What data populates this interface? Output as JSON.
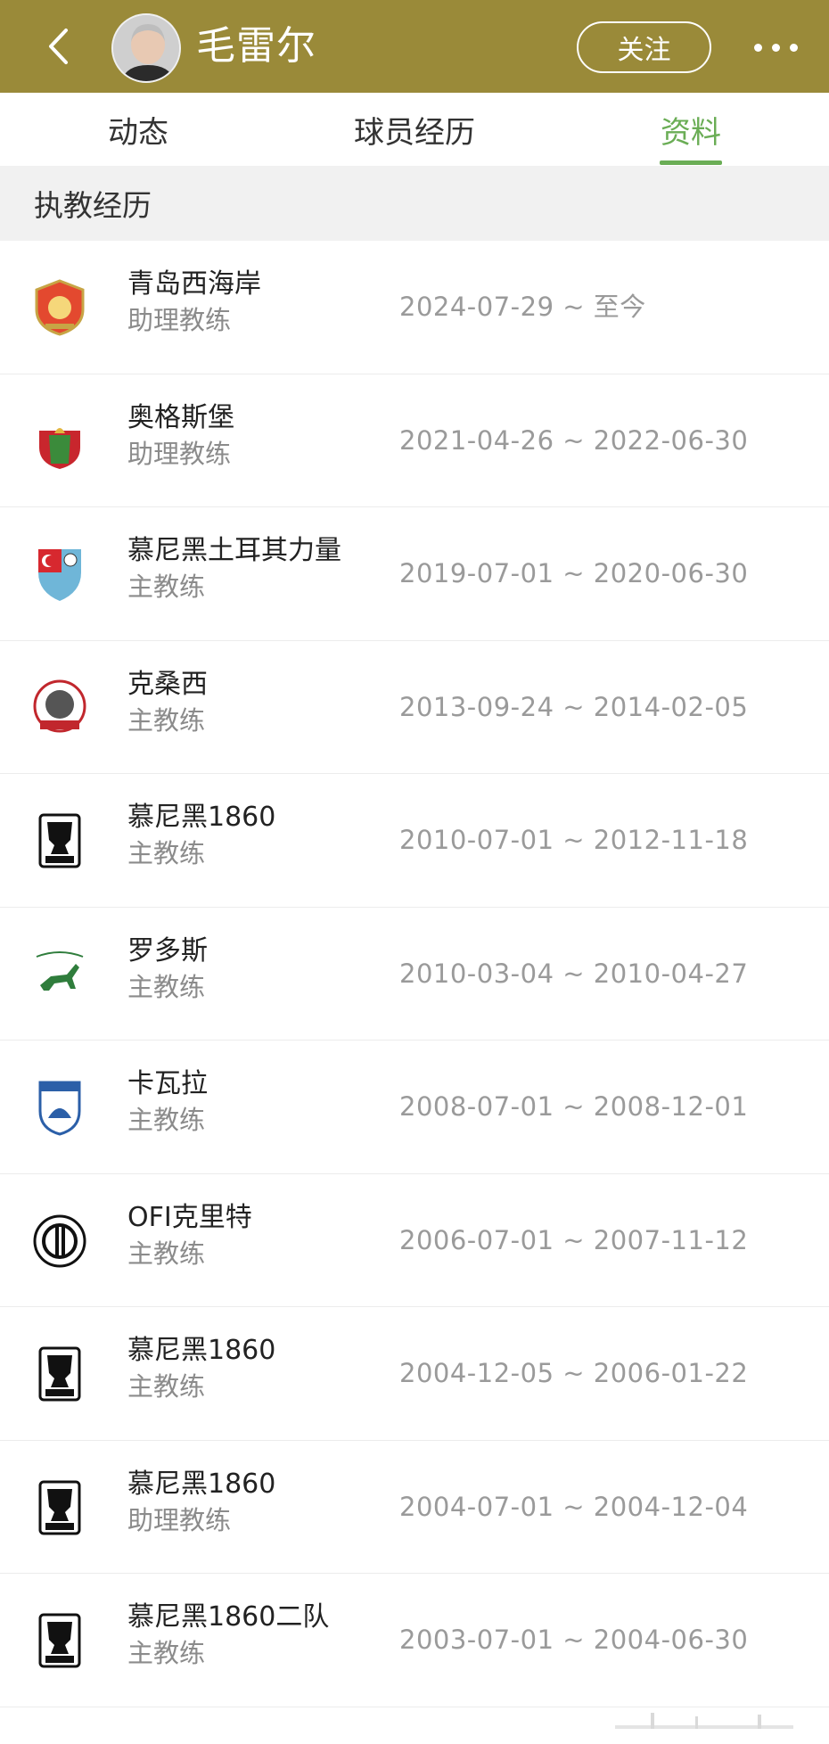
{
  "header": {
    "coach_name": "毛雷尔",
    "follow_label": "关注",
    "icons": {
      "back": "back-icon",
      "more": "more-icon",
      "avatar": "avatar"
    },
    "bg_color": "#9a8a39"
  },
  "tabs": [
    {
      "label": "动态",
      "active": false
    },
    {
      "label": "球员经历",
      "active": false
    },
    {
      "label": "资料",
      "active": true
    }
  ],
  "accent_color": "#6aad55",
  "section": {
    "title": "执教经历"
  },
  "career": [
    {
      "team": "青岛西海岸",
      "role": "助理教练",
      "period": "2024-07-29 ~ 至今",
      "logo": "qingdao-west-coast-logo"
    },
    {
      "team": "奥格斯堡",
      "role": "助理教练",
      "period": "2021-04-26 ~ 2022-06-30",
      "logo": "augsburg-logo"
    },
    {
      "team": "慕尼黑土耳其力量",
      "role": "主教练",
      "period": "2019-07-01 ~ 2020-06-30",
      "logo": "turkgucu-munich-logo"
    },
    {
      "team": "克桑西",
      "role": "主教练",
      "period": "2013-09-24 ~ 2014-02-05",
      "logo": "xanthi-logo"
    },
    {
      "team": "慕尼黑1860",
      "role": "主教练",
      "period": "2010-07-01 ~ 2012-11-18",
      "logo": "munich-1860-logo"
    },
    {
      "team": "罗多斯",
      "role": "主教练",
      "period": "2010-03-04 ~ 2010-04-27",
      "logo": "rodos-logo"
    },
    {
      "team": "卡瓦拉",
      "role": "主教练",
      "period": "2008-07-01 ~ 2008-12-01",
      "logo": "kavala-logo"
    },
    {
      "team": "OFI克里特",
      "role": "主教练",
      "period": "2006-07-01 ~ 2007-11-12",
      "logo": "ofi-crete-logo"
    },
    {
      "team": "慕尼黑1860",
      "role": "主教练",
      "period": "2004-12-05 ~ 2006-01-22",
      "logo": "munich-1860-logo"
    },
    {
      "team": "慕尼黑1860",
      "role": "助理教练",
      "period": "2004-07-01 ~ 2004-12-04",
      "logo": "munich-1860-logo"
    },
    {
      "team": "慕尼黑1860二队",
      "role": "主教练",
      "period": "2003-07-01 ~ 2004-06-30",
      "logo": "munich-1860-logo"
    }
  ]
}
